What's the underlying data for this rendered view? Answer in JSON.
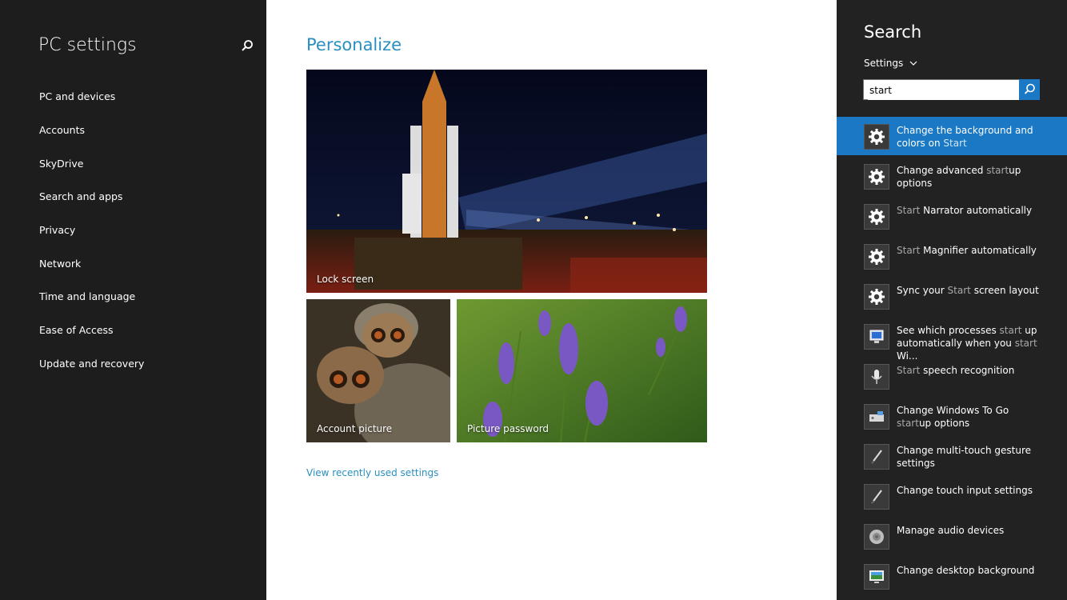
{
  "left": {
    "title": "PC settings",
    "nav": [
      "PC and devices",
      "Accounts",
      "SkyDrive",
      "Search and apps",
      "Privacy",
      "Network",
      "Time and language",
      "Ease of Access",
      "Update and recovery"
    ]
  },
  "main": {
    "heading": "Personalize",
    "tiles": {
      "lock": "Lock screen",
      "account": "Account picture",
      "password": "Picture password"
    },
    "recent_link": "View recently used settings"
  },
  "search": {
    "title": "Search",
    "scope": "Settings",
    "query": "start",
    "results": [
      {
        "parts": [
          "Change the background and colors on ",
          "Start"
        ],
        "icon": "gear-icon"
      },
      {
        "parts": [
          "Change advanced ",
          "start",
          "up options"
        ],
        "icon": "gear-icon"
      },
      {
        "parts": [
          "Start",
          " Narrator automatically"
        ],
        "icon": "gear-icon"
      },
      {
        "parts": [
          "Start",
          " Magnifier automatically"
        ],
        "icon": "gear-icon"
      },
      {
        "parts": [
          "Sync your ",
          "Start",
          " screen layout"
        ],
        "icon": "gear-icon"
      },
      {
        "parts": [
          "See which processes ",
          "start",
          " up automatically when you ",
          "start",
          " Wi..."
        ],
        "icon": "monitor-icon"
      },
      {
        "parts": [
          "Start",
          " speech recognition"
        ],
        "icon": "microphone-icon"
      },
      {
        "parts": [
          "Change Windows To Go ",
          "start",
          "up options"
        ],
        "icon": "drive-icon"
      },
      {
        "parts": [
          "Change multi-touch gesture settings"
        ],
        "icon": "pen-icon"
      },
      {
        "parts": [
          "Change touch input settings"
        ],
        "icon": "pen-icon"
      },
      {
        "parts": [
          "Manage audio devices"
        ],
        "icon": "speaker-icon"
      },
      {
        "parts": [
          "Change desktop background"
        ],
        "icon": "desktop-icon"
      }
    ]
  }
}
